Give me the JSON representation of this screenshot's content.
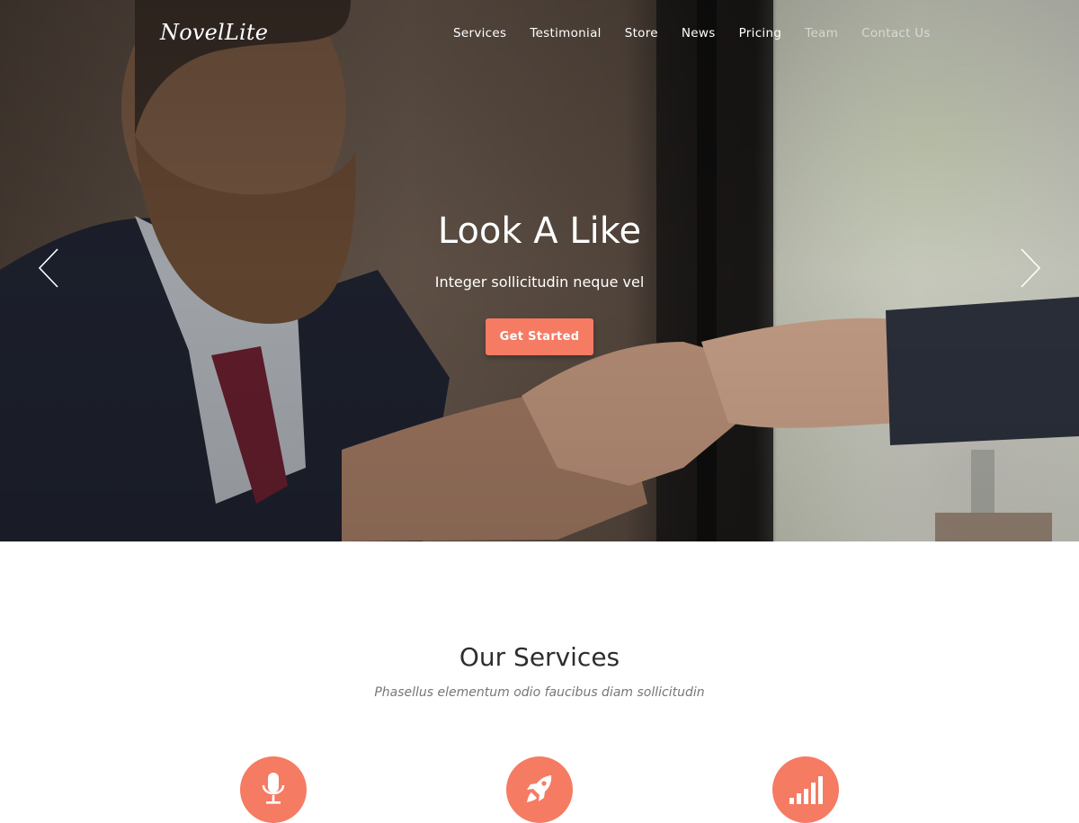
{
  "brand": {
    "logo_text": "NovelLite"
  },
  "nav": {
    "items": [
      {
        "label": "Services"
      },
      {
        "label": "Testimonial"
      },
      {
        "label": "Store"
      },
      {
        "label": "News"
      },
      {
        "label": "Pricing"
      },
      {
        "label": "Team"
      },
      {
        "label": "Contact Us"
      }
    ]
  },
  "hero": {
    "title": "Look A Like",
    "subtitle": "Integer sollicitudin neque vel",
    "button_label": "Get Started",
    "prev_icon": "chevron-left-icon",
    "next_icon": "chevron-right-icon"
  },
  "services": {
    "title": "Our Services",
    "subtitle": "Phasellus elementum odio faucibus diam sollicitudin",
    "icons": [
      "microphone-icon",
      "rocket-icon",
      "bar-chart-icon"
    ]
  },
  "colors": {
    "accent": "#f57b63"
  }
}
